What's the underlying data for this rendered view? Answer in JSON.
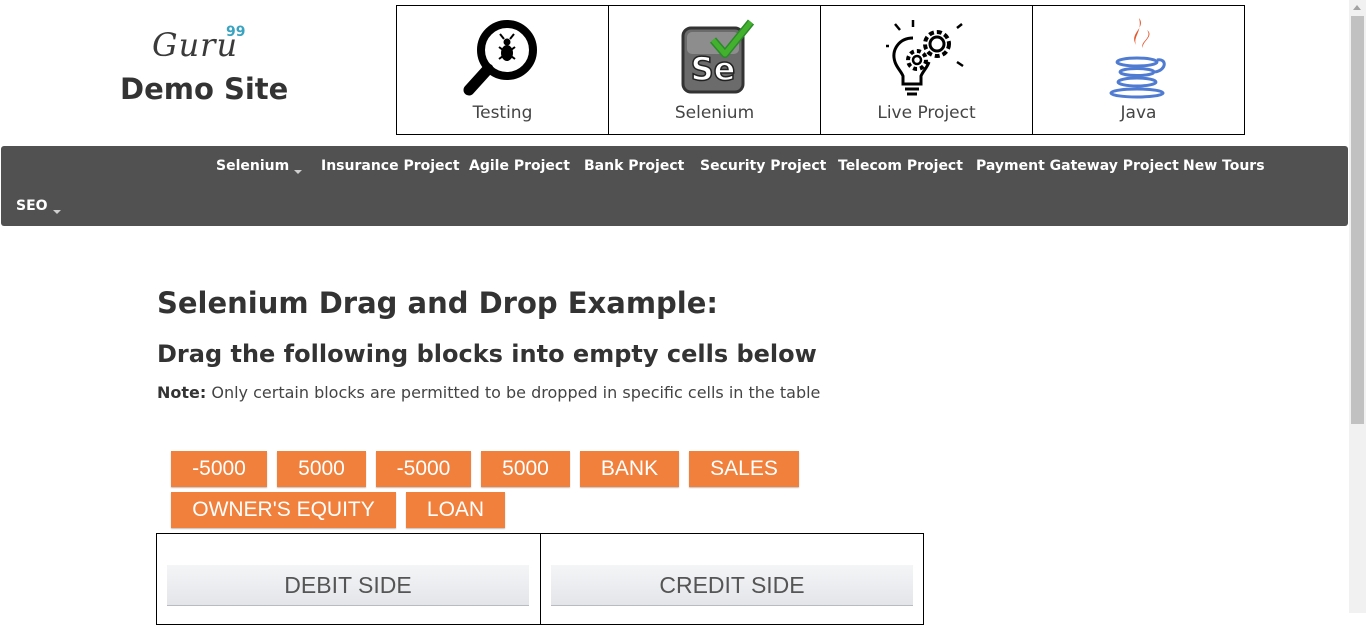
{
  "logo": {
    "brand": "Guru",
    "superscript": "99",
    "subtitle": "Demo Site"
  },
  "courses": [
    {
      "label": "Testing",
      "icon": "magnifier-bug-icon"
    },
    {
      "label": "Selenium",
      "icon": "selenium-check-icon"
    },
    {
      "label": "Live Project",
      "icon": "bulb-gears-icon"
    },
    {
      "label": "Java",
      "icon": "java-cup-icon"
    }
  ],
  "nav": {
    "items": [
      "Selenium",
      "Insurance Project",
      "Agile Project",
      "Bank Project",
      "Security Project",
      "Telecom Project",
      "Payment Gateway Project",
      "New Tours",
      "SEO"
    ]
  },
  "main": {
    "title": "Selenium Drag and Drop Example:",
    "subtitle": "Drag the following blocks into empty cells below",
    "note_label": "Note:",
    "note_text": "Only certain blocks are permitted to be dropped in specific cells in the table"
  },
  "blocks": [
    "-5000",
    "5000",
    "-5000",
    "5000",
    "BANK",
    "SALES",
    "OWNER'S EQUITY",
    "LOAN"
  ],
  "table": {
    "debit_header": "DEBIT SIDE",
    "credit_header": "CREDIT SIDE"
  },
  "colors": {
    "block": "#f0803c",
    "nav": "#515151",
    "accent": "#3aa3c0"
  }
}
